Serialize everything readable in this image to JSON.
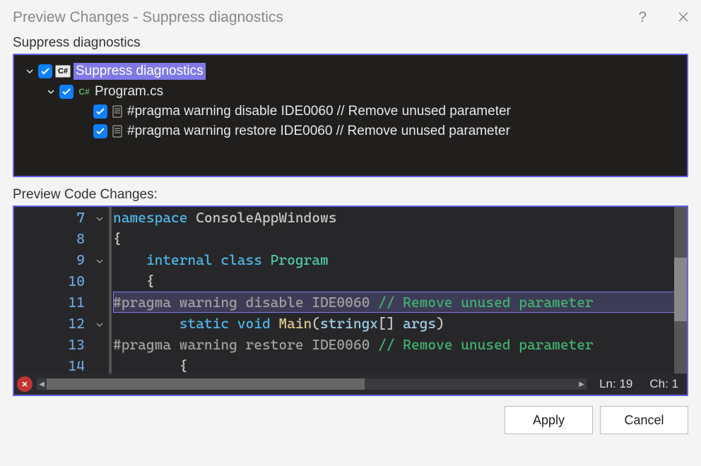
{
  "window": {
    "title": "Preview Changes - Suppress diagnostics"
  },
  "sections": {
    "tree_label": "Suppress diagnostics",
    "code_label": "Preview Code Changes:"
  },
  "tree": {
    "root": {
      "label": "Suppress diagnostics",
      "badge": "C#",
      "checked": true,
      "expanded": true
    },
    "file": {
      "label": "Program.cs",
      "icon_text": "C#",
      "checked": true,
      "expanded": true
    },
    "pragma_disable": {
      "label": "#pragma warning disable IDE0060 // Remove unused parameter",
      "checked": true
    },
    "pragma_restore": {
      "label": "#pragma warning restore IDE0060 // Remove unused parameter",
      "checked": true
    }
  },
  "code": {
    "lines": [
      {
        "num": "7",
        "fold": true,
        "tokens": [
          {
            "t": "namespace",
            "c": "kw-blue"
          },
          {
            "t": " ",
            "c": ""
          },
          {
            "t": "ConsoleAppWindows",
            "c": "kw-punc"
          }
        ]
      },
      {
        "num": "8",
        "tokens": [
          {
            "t": "{",
            "c": "kw-punc"
          }
        ]
      },
      {
        "num": "9",
        "fold": true,
        "tokens": [
          {
            "t": "    ",
            "c": ""
          },
          {
            "t": "internal",
            "c": "kw-blue"
          },
          {
            "t": " ",
            "c": ""
          },
          {
            "t": "class",
            "c": "kw-blue"
          },
          {
            "t": " ",
            "c": ""
          },
          {
            "t": "Program",
            "c": "kw-type"
          }
        ]
      },
      {
        "num": "10",
        "tokens": [
          {
            "t": "    {",
            "c": "kw-punc"
          }
        ]
      },
      {
        "num": "11",
        "hl": true,
        "tokens": [
          {
            "t": "#pragma",
            "c": "kw-pragma"
          },
          {
            "t": " ",
            "c": ""
          },
          {
            "t": "warning",
            "c": "kw-pragma"
          },
          {
            "t": " ",
            "c": ""
          },
          {
            "t": "disable",
            "c": "kw-pragma"
          },
          {
            "t": " ",
            "c": ""
          },
          {
            "t": "IDE0060",
            "c": "kw-pragma"
          },
          {
            "t": " ",
            "c": ""
          },
          {
            "t": "// Remove unused parameter",
            "c": "kw-comment"
          }
        ]
      },
      {
        "num": "12",
        "fold": true,
        "tokens": [
          {
            "t": "        ",
            "c": ""
          },
          {
            "t": "static",
            "c": "kw-blue"
          },
          {
            "t": " ",
            "c": ""
          },
          {
            "t": "void",
            "c": "kw-blue"
          },
          {
            "t": " ",
            "c": ""
          },
          {
            "t": "Main",
            "c": "kw-method"
          },
          {
            "t": "(",
            "c": "kw-punc"
          },
          {
            "t": "stringx",
            "c": "kw-param"
          },
          {
            "t": "[] ",
            "c": "kw-punc"
          },
          {
            "t": "args",
            "c": "kw-param"
          },
          {
            "t": ")",
            "c": "kw-punc"
          }
        ]
      },
      {
        "num": "13",
        "tokens": [
          {
            "t": "#pragma",
            "c": "kw-pragma"
          },
          {
            "t": " ",
            "c": ""
          },
          {
            "t": "warning",
            "c": "kw-pragma"
          },
          {
            "t": " ",
            "c": ""
          },
          {
            "t": "restore",
            "c": "kw-pragma"
          },
          {
            "t": " ",
            "c": ""
          },
          {
            "t": "IDE0060",
            "c": "kw-pragma"
          },
          {
            "t": " ",
            "c": ""
          },
          {
            "t": "// Remove unused parameter",
            "c": "kw-comment"
          }
        ]
      },
      {
        "num": "14",
        "tokens": [
          {
            "t": "        {",
            "c": "kw-punc"
          }
        ]
      }
    ],
    "status_line": "Ln: 19",
    "status_col": "Ch: 1"
  },
  "buttons": {
    "apply": "Apply",
    "cancel": "Cancel"
  }
}
